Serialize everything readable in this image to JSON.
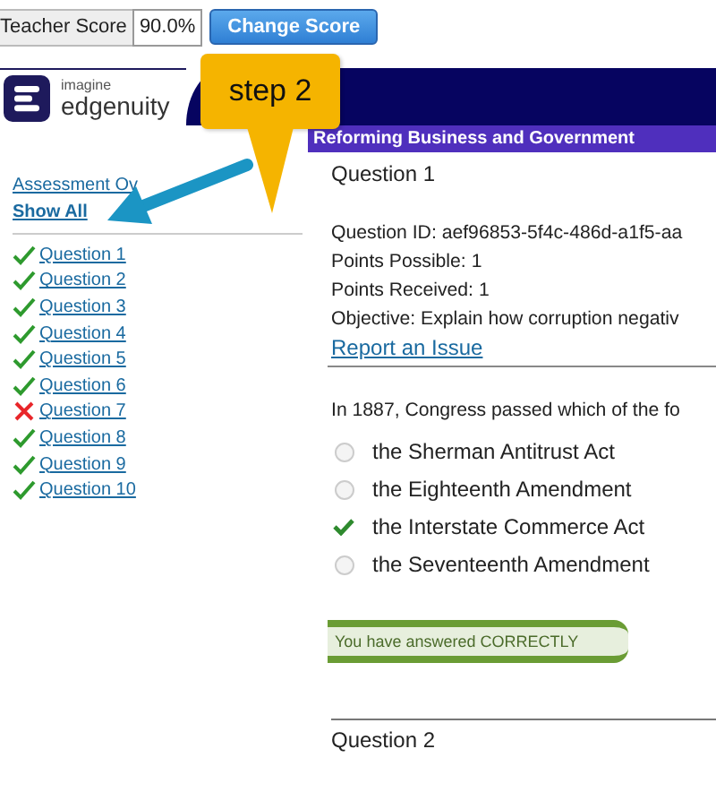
{
  "toolbar": {
    "score_label": "Teacher Score",
    "score_value": "90.0%",
    "button": "Change Score"
  },
  "header": {
    "logo_small": "imagine",
    "logo_large": "edgenuity",
    "section_title": "Reforming Business and Government"
  },
  "callout": {
    "text": "step 2"
  },
  "sidebar": {
    "overview_link": "Assessment Ov",
    "show_all": "Show All",
    "questions": [
      {
        "label": "Question 1",
        "correct": true
      },
      {
        "label": "Question 2",
        "correct": true
      },
      {
        "label": "Question 3",
        "correct": true
      },
      {
        "label": "Question 4",
        "correct": true
      },
      {
        "label": "Question 5",
        "correct": true
      },
      {
        "label": "Question 6",
        "correct": true
      },
      {
        "label": "Question 7",
        "correct": false
      },
      {
        "label": "Question 8",
        "correct": true
      },
      {
        "label": "Question 9",
        "correct": true
      },
      {
        "label": "Question 10",
        "correct": true
      }
    ]
  },
  "question": {
    "title": "Question 1",
    "details": [
      "Question ID: aef96853-5f4c-486d-a1f5-aa",
      "Points Possible: 1",
      "Points Received: 1",
      "Objective: Explain how corruption negativ"
    ],
    "report_link": "Report an Issue",
    "prompt": "In 1887, Congress passed which of the fo",
    "options": [
      {
        "text": "the Sherman Antitrust Act",
        "selected": false
      },
      {
        "text": "the Eighteenth Amendment",
        "selected": false
      },
      {
        "text": "the Interstate Commerce Act",
        "selected": true
      },
      {
        "text": "the Seventeenth Amendment",
        "selected": false
      }
    ],
    "result": "You have answered CORRECTLY",
    "next_title": "Question 2"
  }
}
